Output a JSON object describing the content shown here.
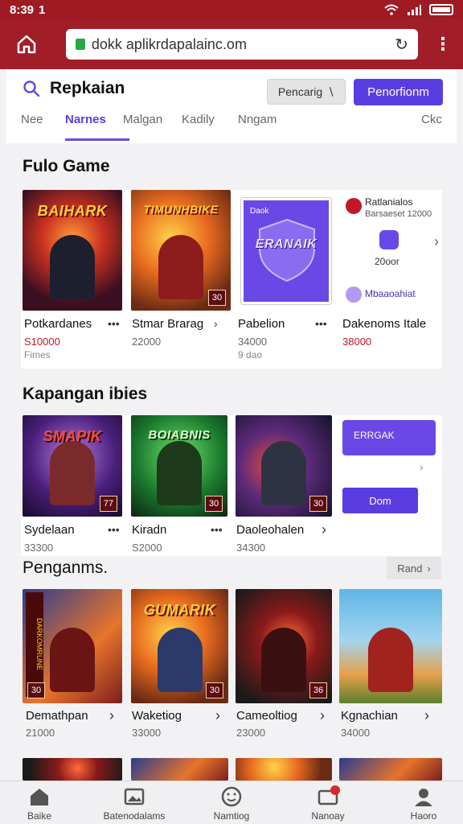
{
  "status_bar": {
    "time": "8:39",
    "extra": "1"
  },
  "browser": {
    "url": "dokk aplikrdapalainc.om"
  },
  "header": {
    "title": "Repkaian",
    "secondary_button": "Pencarig",
    "primary_button": "Penorfionm"
  },
  "tabs": [
    {
      "label": "Nee"
    },
    {
      "label": "Narnes"
    },
    {
      "label": "Malgan"
    },
    {
      "label": "Kadily"
    },
    {
      "label": "Nngam"
    },
    {
      "label": "Ckc"
    }
  ],
  "section1": {
    "title": "Fulo Game",
    "items": [
      {
        "art": "BAIHARK",
        "name": "Potkardanes",
        "price": "S10000",
        "sub": "Fimes",
        "badge": ""
      },
      {
        "art": "TIMUNHBIKE",
        "name": "Stmar Brarag",
        "price": "22000",
        "sub": "",
        "badge": "30"
      },
      {
        "art": "ERANAIK",
        "name": "Pabelion",
        "price": "34000",
        "sub": "9 dao",
        "badge": ""
      },
      {
        "name": "Dakenoms Itale",
        "price": "38000"
      }
    ],
    "promo": {
      "header": "Ratlanialos",
      "sub": "Barsaeset 12000",
      "amount": "20oor",
      "footer": "Mbaaoahiat",
      "shield_label": "Daok"
    }
  },
  "section2": {
    "title": "Kapangan ibies",
    "items": [
      {
        "art": "SMAPIK",
        "name": "Sydelaan",
        "price": "33300",
        "badge": "77"
      },
      {
        "art": "BOIABNIS",
        "name": "Kiradn",
        "price": "S2000",
        "badge": "30"
      },
      {
        "art": "",
        "name": "Daoleohalen",
        "price": "34300",
        "badge": "30"
      }
    ],
    "promo": {
      "top_button": "ERRGAK",
      "bottom_button": "Dom"
    }
  },
  "section3": {
    "title": "Penganms.",
    "more_button": "Rand",
    "items": [
      {
        "art": "DARKOMRUNE",
        "name": "Demathpan",
        "price": "21000",
        "badge": "30"
      },
      {
        "art": "GUMARIK",
        "name": "Waketiog",
        "price": "33000",
        "badge": "30"
      },
      {
        "art": "",
        "name": "Cameoltiog",
        "price": "23000",
        "badge": "36"
      },
      {
        "art": "",
        "name": "Kgnachian",
        "price": "34000",
        "badge": ""
      }
    ]
  },
  "bottom_nav": [
    {
      "label": "Baike",
      "icon": "home-icon"
    },
    {
      "label": "Batenodalams",
      "icon": "image-icon"
    },
    {
      "label": "Namtiog",
      "icon": "smile-icon"
    },
    {
      "label": "Nanoay",
      "icon": "notification-icon"
    },
    {
      "label": "Haoro",
      "icon": "profile-icon"
    }
  ],
  "colors": {
    "brand_red": "#a11d27",
    "accent_purple": "#5a3de0",
    "price_red": "#c0182a"
  }
}
